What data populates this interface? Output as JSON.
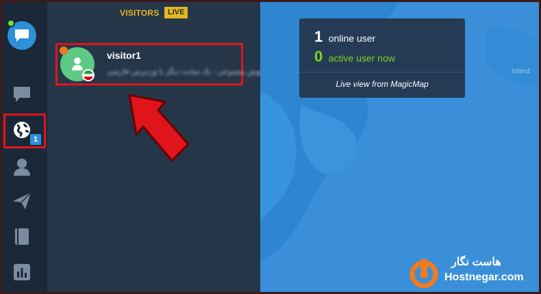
{
  "sidebar": {
    "items": [
      {
        "name": "chat",
        "icon": "chat-icon"
      },
      {
        "name": "visitors",
        "icon": "globe-icon",
        "badge": "1"
      },
      {
        "name": "contacts",
        "icon": "user-icon"
      },
      {
        "name": "campaigns",
        "icon": "send-icon"
      },
      {
        "name": "knowledge",
        "icon": "book-icon"
      },
      {
        "name": "reports",
        "icon": "bar-chart-icon"
      }
    ]
  },
  "visitors_panel": {
    "title": "VISITORS",
    "live_label": "LIVE",
    "visitors": [
      {
        "name": "visitor1",
        "subtitle": "هوش مصنوعی - یک سایت دیگر با وردپرس فارسی",
        "flag": "iran",
        "status_color": "#f07a22"
      }
    ]
  },
  "map": {
    "stats": {
      "online_count": "1",
      "online_label": "online user",
      "active_count": "0",
      "active_label": "active user now",
      "caption": "Live view from MagicMap"
    },
    "label": "Island"
  },
  "brand": {
    "name_fa": "هاست نگار",
    "name_en": "Hostnegar.com"
  },
  "colors": {
    "accent": "#2f8fd8",
    "live": "#e6b71e",
    "active_green": "#7fd321",
    "highlight_red": "#e0151b"
  }
}
